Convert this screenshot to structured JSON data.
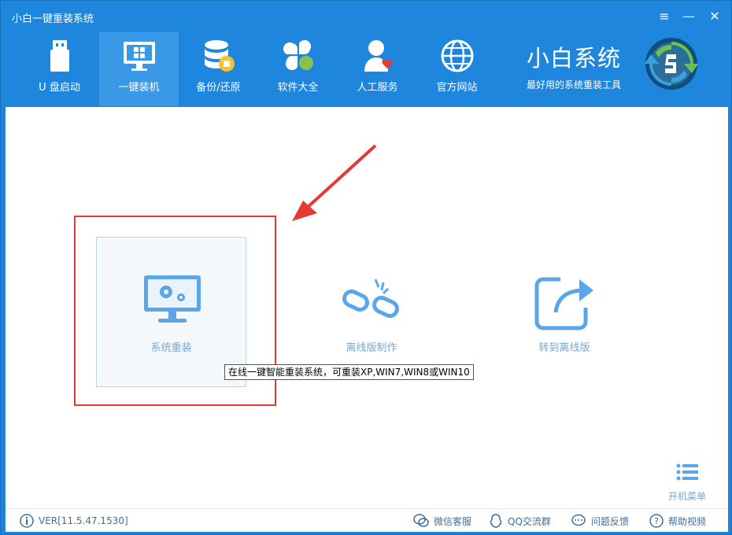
{
  "window": {
    "title": "小白一键重装系统",
    "controls": {
      "menu": "≡",
      "minimize": "—",
      "close": "✕"
    }
  },
  "nav": {
    "items": [
      {
        "label": "U 盘启动",
        "icon": "usb-drive-icon"
      },
      {
        "label": "一键装机",
        "icon": "monitor-windows-icon",
        "active": true
      },
      {
        "label": "备份/还原",
        "icon": "database-backup-icon"
      },
      {
        "label": "软件大全",
        "icon": "apps-grid-icon"
      },
      {
        "label": "人工服务",
        "icon": "support-person-icon"
      },
      {
        "label": "官方网站",
        "icon": "globe-icon"
      }
    ]
  },
  "brand": {
    "title": "小白系统",
    "subtitle": "最好用的系统重装工具"
  },
  "main": {
    "cards": [
      {
        "label": "系统重装",
        "icon": "monitor-gears-icon"
      },
      {
        "label": "离线版制作",
        "icon": "broken-link-icon"
      },
      {
        "label": "转到离线版",
        "icon": "share-arrow-icon"
      }
    ],
    "tooltip": "在线一键智能重装系统，可重装XP,WIN7,WIN8或WIN10",
    "boot_menu": "开机菜单"
  },
  "footer": {
    "version": "VER[11.5.47.1530]",
    "links": [
      "微信客服",
      "QQ交流群",
      "问题反馈",
      "帮助视频"
    ]
  },
  "colors": {
    "header_bg": "#1e86dc",
    "active_tab_bg": "#3a99e6",
    "accent_icon": "#5ba6e8",
    "highlight_red": "#e53935"
  }
}
